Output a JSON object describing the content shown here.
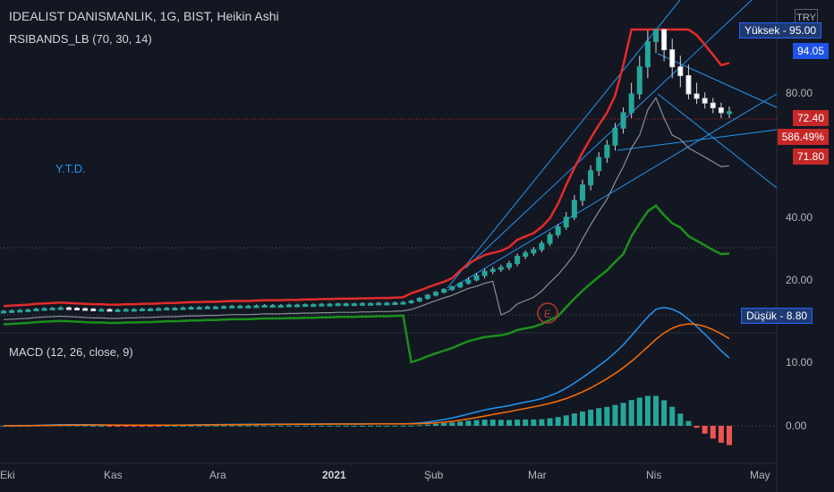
{
  "header": {
    "title": "IDEALIST DANISMANLIK, 1G, BIST, Heikin Ashi",
    "indicator": "RSIBANDS_LB (70, 30, 14)",
    "macd": "MACD (12, 26, close, 9)"
  },
  "currency": "TRY",
  "annotations": {
    "ytd": "Y.T.D.",
    "event_marker": "E"
  },
  "highlow": {
    "high_label": "Yüksek",
    "high_value": "95.00",
    "low_label": "Düşük",
    "low_value": "8.80"
  },
  "price_axis": {
    "ticks": [
      "80.00",
      "40.00",
      "20.00"
    ],
    "tags": {
      "band_upper": "94.05",
      "last": "72.40",
      "change": "586.49%",
      "band_lower": "71.80"
    }
  },
  "macd_axis": {
    "ticks": [
      "10.00",
      "0.00"
    ]
  },
  "time_axis": [
    "Eki",
    "Kas",
    "Ara",
    "2021",
    "Şub",
    "Mar",
    "Nis",
    "May"
  ],
  "colors": {
    "background": "#131722",
    "up": "#26a69a",
    "down": "#ef5350",
    "band_upper": "#e32b2b",
    "band_lower": "#1b8f1b",
    "trendline": "#2196f3",
    "macd_line": "#2196f3",
    "signal_line": "#ff6d00",
    "last_price": "#c62828"
  },
  "chart_data": {
    "type": "candlestick",
    "ohlc_close_approx": [
      9.6,
      9.7,
      9.8,
      9.9,
      10.1,
      10.2,
      10.3,
      10.4,
      10.3,
      10.2,
      10.1,
      10.0,
      10.0,
      9.9,
      9.9,
      10.0,
      10.0,
      10.1,
      10.1,
      10.2,
      10.3,
      10.3,
      10.4,
      10.5,
      10.5,
      10.6,
      10.6,
      10.7,
      10.8,
      10.8,
      10.8,
      10.9,
      11.0,
      11.0,
      11.0,
      11.1,
      11.1,
      11.2,
      11.2,
      11.3,
      11.3,
      11.4,
      11.4,
      11.4,
      11.5,
      11.5,
      11.6,
      11.6,
      11.7,
      11.8,
      12.2,
      13.0,
      14.0,
      15.0,
      16.0,
      17.0,
      18.5,
      20,
      21,
      22,
      22.5,
      23,
      24,
      26,
      27,
      28,
      30,
      33,
      36,
      40,
      44,
      48,
      52,
      56,
      60,
      66,
      72,
      80,
      86,
      92,
      95,
      90,
      86,
      84,
      80,
      78,
      76,
      74,
      72,
      72.4
    ],
    "last": 72.4,
    "change_pct": "586.49%",
    "macd_y_range": [
      -2,
      12
    ]
  }
}
